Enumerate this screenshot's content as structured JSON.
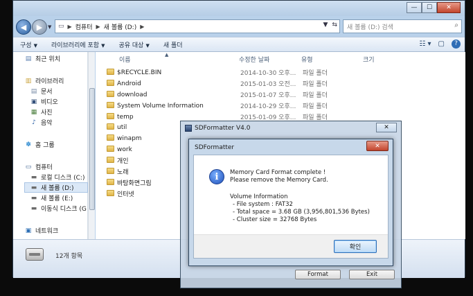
{
  "window": {
    "controls": [
      "—",
      "☐",
      "✕"
    ]
  },
  "nav": {
    "breadcrumbs": [
      "컴퓨터",
      "새 볼륨 (D:)"
    ],
    "search_placeholder": "새 볼륨 (D:) 검색"
  },
  "toolbar": {
    "items": [
      "구성",
      "라이브러리에 포함",
      "공유 대상",
      "새 폴더"
    ]
  },
  "sidebar": {
    "items": [
      {
        "label": "최근 위치",
        "icon": "recent-places-icon"
      },
      {
        "label": "라이브러리",
        "icon": "library-icon"
      },
      {
        "label": "문서",
        "icon": "documents-icon"
      },
      {
        "label": "비디오",
        "icon": "video-icon"
      },
      {
        "label": "사진",
        "icon": "pictures-icon"
      },
      {
        "label": "음악",
        "icon": "music-icon"
      },
      {
        "label": "홈 그룹",
        "icon": "homegroup-icon"
      },
      {
        "label": "컴퓨터",
        "icon": "computer-icon"
      },
      {
        "label": "로컬 디스크 (C:)",
        "icon": "local-disk-icon"
      },
      {
        "label": "새 볼륨 (D:)",
        "icon": "drive-icon"
      },
      {
        "label": "새 볼륨 (E:)",
        "icon": "drive-icon"
      },
      {
        "label": "이동식 디스크 (G",
        "icon": "removable-disk-icon"
      },
      {
        "label": "네트워크",
        "icon": "network-icon"
      }
    ]
  },
  "columns": {
    "name": "이름",
    "date": "수정한 날짜",
    "type": "유형",
    "size": "크기"
  },
  "files": [
    {
      "name": "$RECYCLE.BIN",
      "date": "2014-10-30 오후...",
      "type": "파일 폴더"
    },
    {
      "name": "Android",
      "date": "2015-01-03 오전...",
      "type": "파일 폴더"
    },
    {
      "name": "download",
      "date": "2015-01-07 오후...",
      "type": "파일 폴더"
    },
    {
      "name": "System Volume Information",
      "date": "2014-10-29 오후...",
      "type": "파일 폴더"
    },
    {
      "name": "temp",
      "date": "2015-01-09 오후...",
      "type": "파일 폴더"
    },
    {
      "name": "util",
      "date": "",
      "type": ""
    },
    {
      "name": "winapm",
      "date": "",
      "type": ""
    },
    {
      "name": "work",
      "date": "",
      "type": ""
    },
    {
      "name": "개인",
      "date": "",
      "type": ""
    },
    {
      "name": "노래",
      "date": "",
      "type": ""
    },
    {
      "name": "바탕화면그림",
      "date": "",
      "type": ""
    },
    {
      "name": "인터넷",
      "date": "",
      "type": ""
    }
  ],
  "status": {
    "item_count": "12개 항목"
  },
  "sdformatter": {
    "title": "SDFormatter V4.0",
    "close": "✕",
    "format_label": "Format",
    "exit_label": "Exit"
  },
  "dialog": {
    "title": "SDFormatter",
    "close": "✕",
    "icon": "info-icon",
    "lines": [
      "Memory Card Format complete !",
      "Please remove the Memory Card.",
      "Volume Information",
      "- File system : FAT32",
      "- Total space = 3.68 GB (3,956,801,536 Bytes)",
      "- Cluster size = 32768 Bytes"
    ],
    "ok_label": "확인"
  }
}
